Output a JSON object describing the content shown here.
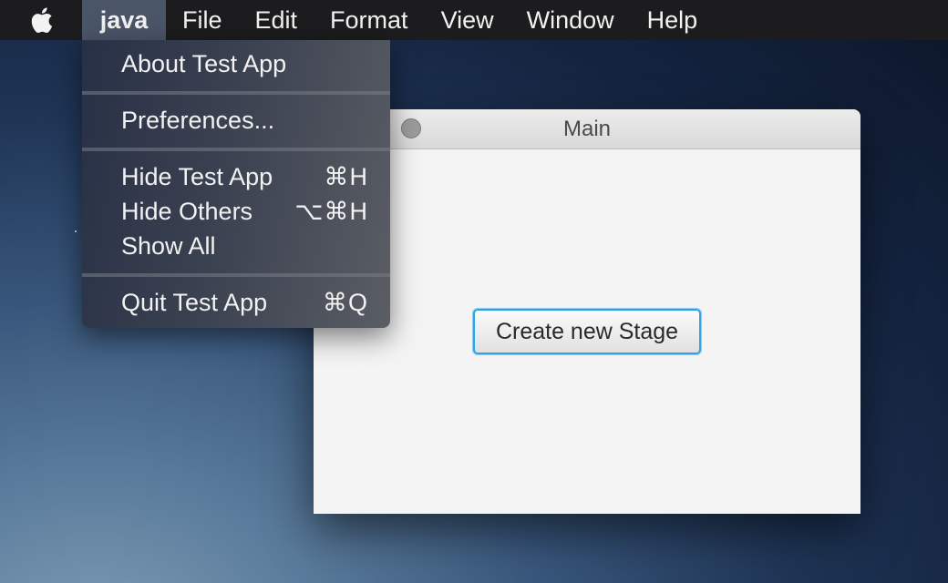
{
  "menubar": {
    "apple_icon": "apple-logo-icon",
    "app_menu": "java",
    "items": [
      "File",
      "Edit",
      "Format",
      "View",
      "Window",
      "Help"
    ]
  },
  "window": {
    "title": "Main",
    "button_label": "Create new Stage"
  },
  "app_menu_dropdown": {
    "about": "About Test App",
    "preferences": "Preferences...",
    "hide": {
      "label": "Hide Test App",
      "shortcut": "⌘H"
    },
    "hide_others": {
      "label": "Hide Others",
      "shortcut": "⌥⌘H"
    },
    "show_all": "Show All",
    "quit": {
      "label": "Quit Test App",
      "shortcut": "⌘Q"
    }
  },
  "colors": {
    "menubar_bg": "#1c1c1e",
    "menu_highlight": "#4b5568",
    "focus_ring": "#2ea3e6",
    "window_bg": "#f4f4f4"
  }
}
